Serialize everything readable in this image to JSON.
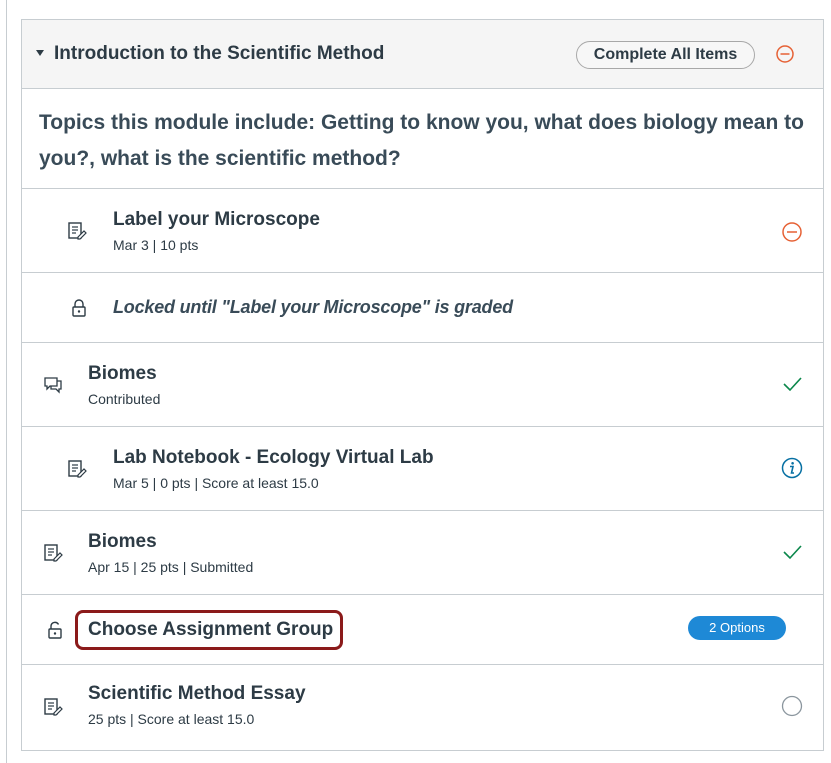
{
  "module": {
    "title": "Introduction to the Scientific Method",
    "complete_all_label": "Complete All Items",
    "header_status_icon": "minus-circle-icon",
    "description": "Topics this module include: Getting to know you, what does biology mean to you?, what is the scientific method?"
  },
  "items": [
    {
      "title": "Label your Microscope",
      "meta": "Mar 3  |  10 pts",
      "type_icon": "assignment-icon",
      "status_icon": "minus-circle-icon"
    },
    {
      "locked_text": "Locked until \"Label your Microscope\" is graded",
      "type_icon": "lock-icon"
    },
    {
      "title": "Biomes",
      "meta": "Contributed",
      "type_icon": "discussion-icon",
      "status_icon": "check-icon"
    },
    {
      "title": "Lab Notebook - Ecology Virtual Lab",
      "meta": "Mar 5  |  0 pts  |  Score at least 15.0",
      "type_icon": "assignment-icon",
      "status_icon": "info-icon"
    },
    {
      "title": "Biomes",
      "meta": "Apr 15  |  25 pts  |  Submitted",
      "type_icon": "assignment-icon",
      "status_icon": "check-icon"
    },
    {
      "title": "Choose Assignment Group",
      "badge": "2 Options",
      "type_icon": "unlock-icon"
    },
    {
      "title": "Scientific Method Essay",
      "meta": "25 pts  |  Score at least 15.0",
      "type_icon": "assignment-icon",
      "status_icon": "empty-circle-icon"
    }
  ],
  "colors": {
    "warning": "#e66135",
    "success": "#0b874b",
    "info": "#0770a3",
    "badge": "#1e89d6",
    "highlight": "#8b1a1a"
  }
}
